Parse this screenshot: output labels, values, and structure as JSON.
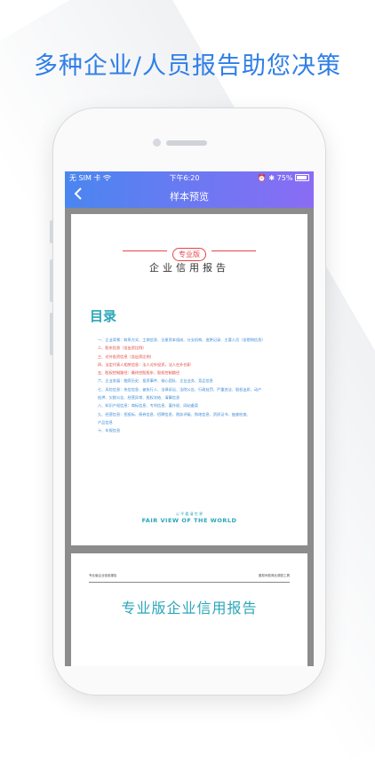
{
  "headline": "多种企业/人员报告助您决策",
  "status_bar": {
    "carrier": "无 SIM 卡 ",
    "wifi_icon": "wifi-icon",
    "time": "下午6:20",
    "battery": "75%"
  },
  "navbar": {
    "back_icon": "chevron-left-icon",
    "title": "样本预览"
  },
  "document": {
    "badge": "专业版",
    "title": "企业信用报告",
    "toc_title": "目录",
    "toc_items": [
      {
        "text": "一、企业背景：联系方式、工商信息、注册资本组成、分支机构、变更记录、主要人员（含猎物信息）",
        "color": "#3b8bd6"
      },
      {
        "text": "二、股东信息（含出资比例）",
        "color": "#e0463f"
      },
      {
        "text": "三、对外投资信息（含出资比例）",
        "color": "#e0463f"
      },
      {
        "text": "四、法定代表人相关信息：法人对外投资，法人在外任职",
        "color": "#e0463f"
      },
      {
        "text": "五、股权控制路径：最终控股股东、股权控制路径",
        "color": "#e0463f"
      },
      {
        "text": "六、企业发展：融资历史、投资事件、核心团队、企业业务、竞品信息",
        "color": "#3b8bd6"
      },
      {
        "text": "七、风险信息：失信信息、被执行人、法律诉讼、法院公告、行政处罚、严重违法、股权出质、动产",
        "color": "#3b8bd6"
      },
      {
        "text": "    抵押、欠税公告、经营异常、股权冻结、清算信息",
        "color": "#3b8bd6"
      },
      {
        "text": "八、知识产权信息：商标信息、专利信息、著作权、网站备案",
        "color": "#3b8bd6"
      },
      {
        "text": "九、经营信息：招投标、债券信息、招聘信息、税务评级、购地信息、资质证书、抽查检查、",
        "color": "#3b8bd6"
      },
      {
        "text": "    产品信息",
        "color": "#3b8bd6"
      },
      {
        "text": "十、年报信息",
        "color": "#3b8bd6"
      }
    ],
    "footer_cn": "公 平 看 清 世 界",
    "footer_en": "FAIR VIEW OF THE WORLD"
  },
  "document2": {
    "header_left": "专业版企业信用报告",
    "header_right": "股权司权商业调查工具",
    "title": "专业版企业信用报告"
  }
}
